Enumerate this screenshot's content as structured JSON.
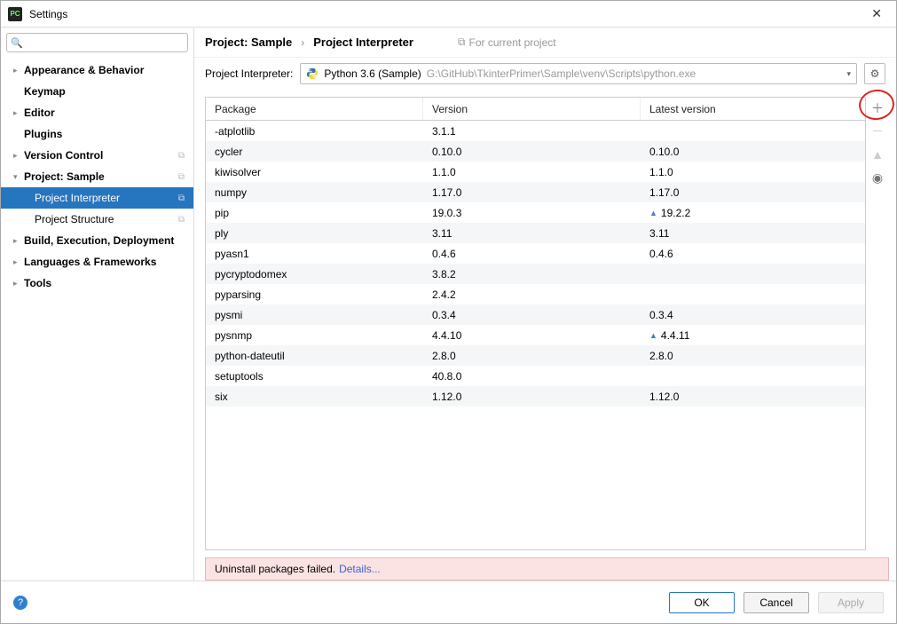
{
  "window": {
    "title": "Settings",
    "logo_text": "PC"
  },
  "search": {
    "placeholder": ""
  },
  "sidebar": {
    "items": [
      {
        "label": "Appearance & Behavior",
        "expandable": true,
        "expanded": false,
        "bold": true
      },
      {
        "label": "Keymap",
        "expandable": false,
        "bold": true
      },
      {
        "label": "Editor",
        "expandable": true,
        "expanded": false,
        "bold": true
      },
      {
        "label": "Plugins",
        "expandable": false,
        "bold": true
      },
      {
        "label": "Version Control",
        "expandable": true,
        "expanded": false,
        "bold": true,
        "badge": true
      },
      {
        "label": "Project: Sample",
        "expandable": true,
        "expanded": true,
        "bold": true,
        "badge": true,
        "children": [
          {
            "label": "Project Interpreter",
            "selected": true,
            "badge": true
          },
          {
            "label": "Project Structure",
            "badge": true
          }
        ]
      },
      {
        "label": "Build, Execution, Deployment",
        "expandable": true,
        "expanded": false,
        "bold": true
      },
      {
        "label": "Languages & Frameworks",
        "expandable": true,
        "expanded": false,
        "bold": true
      },
      {
        "label": "Tools",
        "expandable": true,
        "expanded": false,
        "bold": true
      }
    ]
  },
  "breadcrumb": {
    "item1": "Project: Sample",
    "sep": "›",
    "item2": "Project Interpreter",
    "aux": "For current project"
  },
  "interpreter": {
    "label": "Project Interpreter:",
    "value": "Python 3.6 (Sample)",
    "path": "G:\\GitHub\\TkinterPrimer\\Sample\\venv\\Scripts\\python.exe"
  },
  "table": {
    "headers": {
      "c1": "Package",
      "c2": "Version",
      "c3": "Latest version"
    },
    "rows": [
      {
        "pkg": "-atplotlib",
        "ver": "3.1.1",
        "latest": "",
        "upgrade": false
      },
      {
        "pkg": "cycler",
        "ver": "0.10.0",
        "latest": "0.10.0",
        "upgrade": false
      },
      {
        "pkg": "kiwisolver",
        "ver": "1.1.0",
        "latest": "1.1.0",
        "upgrade": false
      },
      {
        "pkg": "numpy",
        "ver": "1.17.0",
        "latest": "1.17.0",
        "upgrade": false
      },
      {
        "pkg": "pip",
        "ver": "19.0.3",
        "latest": "19.2.2",
        "upgrade": true
      },
      {
        "pkg": "ply",
        "ver": "3.11",
        "latest": "3.11",
        "upgrade": false
      },
      {
        "pkg": "pyasn1",
        "ver": "0.4.6",
        "latest": "0.4.6",
        "upgrade": false
      },
      {
        "pkg": "pycryptodomex",
        "ver": "3.8.2",
        "latest": "",
        "upgrade": false
      },
      {
        "pkg": "pyparsing",
        "ver": "2.4.2",
        "latest": "",
        "upgrade": false
      },
      {
        "pkg": "pysmi",
        "ver": "0.3.4",
        "latest": "0.3.4",
        "upgrade": false
      },
      {
        "pkg": "pysnmp",
        "ver": "4.4.10",
        "latest": "4.4.11",
        "upgrade": true
      },
      {
        "pkg": "python-dateutil",
        "ver": "2.8.0",
        "latest": "2.8.0",
        "upgrade": false
      },
      {
        "pkg": "setuptools",
        "ver": "40.8.0",
        "latest": "",
        "upgrade": false
      },
      {
        "pkg": "six",
        "ver": "1.12.0",
        "latest": "1.12.0",
        "upgrade": false
      }
    ]
  },
  "status": {
    "text": "Uninstall packages failed.",
    "link": "Details..."
  },
  "footer": {
    "ok": "OK",
    "cancel": "Cancel",
    "apply": "Apply"
  }
}
